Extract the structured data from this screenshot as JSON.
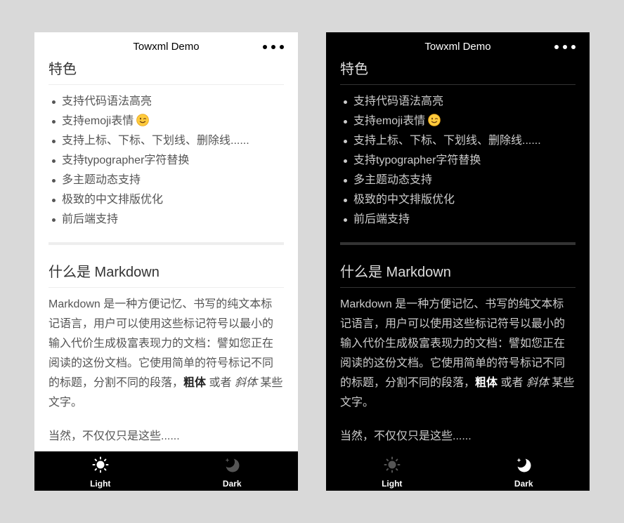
{
  "app": {
    "title": "Towxml Demo",
    "menu_icon": "more-dots-icon"
  },
  "content": {
    "features": {
      "heading": "特色",
      "items": [
        {
          "text": "支持代码语法高亮"
        },
        {
          "text": "支持emoji表情",
          "emoji_icon": "winking-face-emoji-icon"
        },
        {
          "text": "支持上标、下标、下划线、删除线......"
        },
        {
          "text": "支持typographer字符替换"
        },
        {
          "text": "多主题动态支持"
        },
        {
          "text": "极致的中文排版优化"
        },
        {
          "text": "前后端支持"
        }
      ]
    },
    "about": {
      "heading": "什么是 Markdown",
      "paragraph": {
        "lines": [
          "Markdown 是一种方便记忆、书写的纯文本标",
          "记语言，用户可以使用这些标记符号以最小的",
          "输入代价生成极富表现力的文档：譬如您正在",
          "阅读的这份文档。它使用简单的符号标记不同"
        ],
        "line_with_emphasis": {
          "text_before": "的标题，分割不同的段落，",
          "bold": "粗体",
          "text_middle": " 或者 ",
          "italic": "斜体",
          "text_after": " 某些"
        },
        "last_line": "文字。"
      },
      "closing": "当然，不仅仅只是这些......"
    }
  },
  "tabbar": {
    "tabs": [
      {
        "label": "Light",
        "icon": "sun-icon"
      },
      {
        "label": "Dark",
        "icon": "moon-icon"
      }
    ]
  },
  "screens": [
    {
      "dark_mode": false,
      "active_tab_index": 0
    },
    {
      "dark_mode": true,
      "active_tab_index": 1
    }
  ],
  "colors": {
    "page_background": "#d9d9d9",
    "light_screen_background": "#ffffff",
    "dark_screen_background": "#000000",
    "tabbar_background": "#000000",
    "tab_icon_active": "#ffffff",
    "tab_icon_inactive": "#555555"
  }
}
